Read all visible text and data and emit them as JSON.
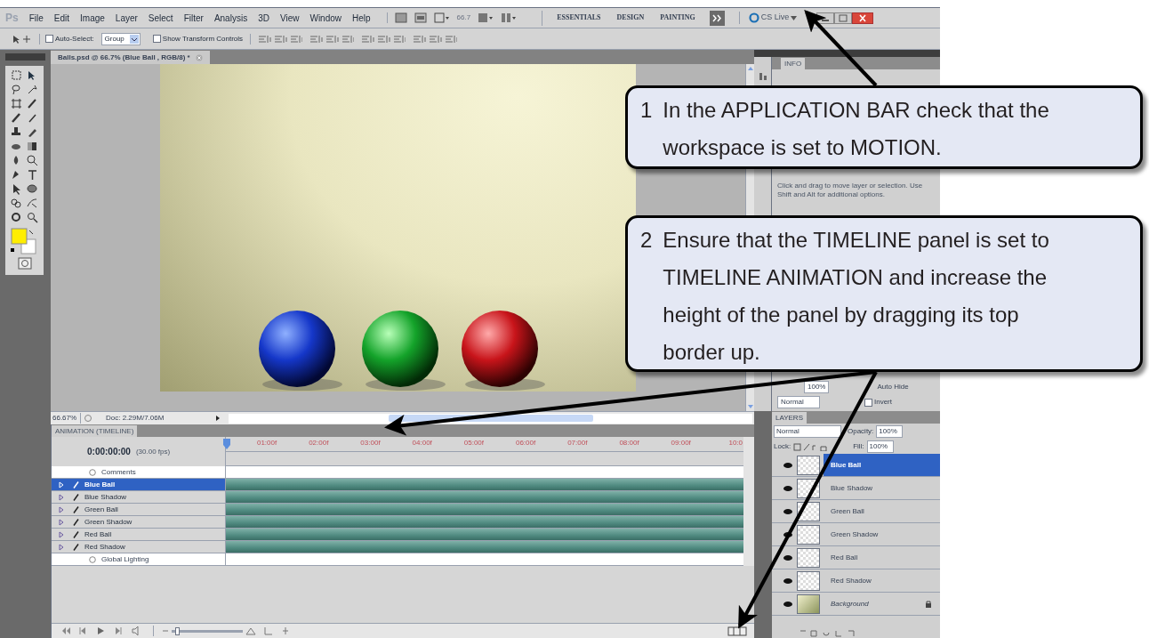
{
  "menu_bar": {
    "logo": "Ps",
    "items": [
      "File",
      "Edit",
      "Image",
      "Layer",
      "Select",
      "Filter",
      "Analysis",
      "3D",
      "View",
      "Window",
      "Help"
    ],
    "zoom": "66.7",
    "workspaces": [
      {
        "label": "ESSENTIALS",
        "selected": false
      },
      {
        "label": "DESIGN",
        "selected": false
      },
      {
        "label": "PAINTING",
        "selected": false
      }
    ],
    "cs_live": "CS Live"
  },
  "options_bar": {
    "auto_select": {
      "label": "Auto-Select:",
      "checked": false
    },
    "auto_select_value": "Group",
    "show_transform": {
      "label": "Show Transform Controls",
      "checked": false
    }
  },
  "document": {
    "tab": "Balls.psd @ 66.7% (Blue Ball , RGB/8) *",
    "zoom": "66.67%",
    "doc_size": "Doc: 2.29M/7.06M"
  },
  "animation_panel": {
    "title": "ANIMATION (TIMELINE)",
    "timecode": "0:00:00:00",
    "fps": "(30.00 fps)",
    "ruler": [
      "01:00f",
      "02:00f",
      "03:00f",
      "04:00f",
      "05:00f",
      "06:00f",
      "07:00f",
      "08:00f",
      "09:00f",
      "10:0"
    ],
    "tracks": [
      {
        "name": "Comments",
        "kind": "global",
        "selected": false
      },
      {
        "name": "Blue Ball",
        "kind": "layer",
        "selected": true
      },
      {
        "name": "Blue Shadow",
        "kind": "layer",
        "selected": false
      },
      {
        "name": "Green Ball",
        "kind": "layer",
        "selected": false
      },
      {
        "name": "Green Shadow",
        "kind": "layer",
        "selected": false
      },
      {
        "name": "Red Ball",
        "kind": "layer",
        "selected": false
      },
      {
        "name": "Red Shadow",
        "kind": "layer",
        "selected": false
      },
      {
        "name": "Global Lighting",
        "kind": "global",
        "selected": false
      }
    ],
    "zoom_slider": {
      "level": 0.05
    }
  },
  "info_panel": {
    "tab": "INFO",
    "hint": "Click and drag to move layer or selection. Use Shift and Alt for additional options."
  },
  "masks_panel": {
    "value": "100%",
    "auto_hide": "Auto Hide",
    "blend": "Normal",
    "invert": {
      "label": "Invert",
      "checked": false
    }
  },
  "layers_panel": {
    "title": "LAYERS",
    "blend": "Normal",
    "opacity_label": "Opacity:",
    "opacity": "100%",
    "lock_label": "Lock:",
    "fill_label": "Fill:",
    "fill": "100%",
    "layers": [
      {
        "name": "Blue Ball",
        "kind": "layer",
        "selected": true
      },
      {
        "name": "Blue Shadow",
        "kind": "layer",
        "selected": false
      },
      {
        "name": "Green Ball",
        "kind": "layer",
        "selected": false
      },
      {
        "name": "Green Shadow",
        "kind": "layer",
        "selected": false
      },
      {
        "name": "Red Ball",
        "kind": "layer",
        "selected": false
      },
      {
        "name": "Red Shadow",
        "kind": "layer",
        "selected": false
      },
      {
        "name": "Background",
        "kind": "background",
        "selected": false
      }
    ]
  },
  "callouts": [
    {
      "number": "1",
      "text": "In the APPLICATION BAR check that the workspace is set to MOTION."
    },
    {
      "number": "2",
      "text": "Ensure that the TIMELINE panel is set to TIMELINE ANIMATION and increase the height of the panel by dragging its top border up."
    }
  ]
}
